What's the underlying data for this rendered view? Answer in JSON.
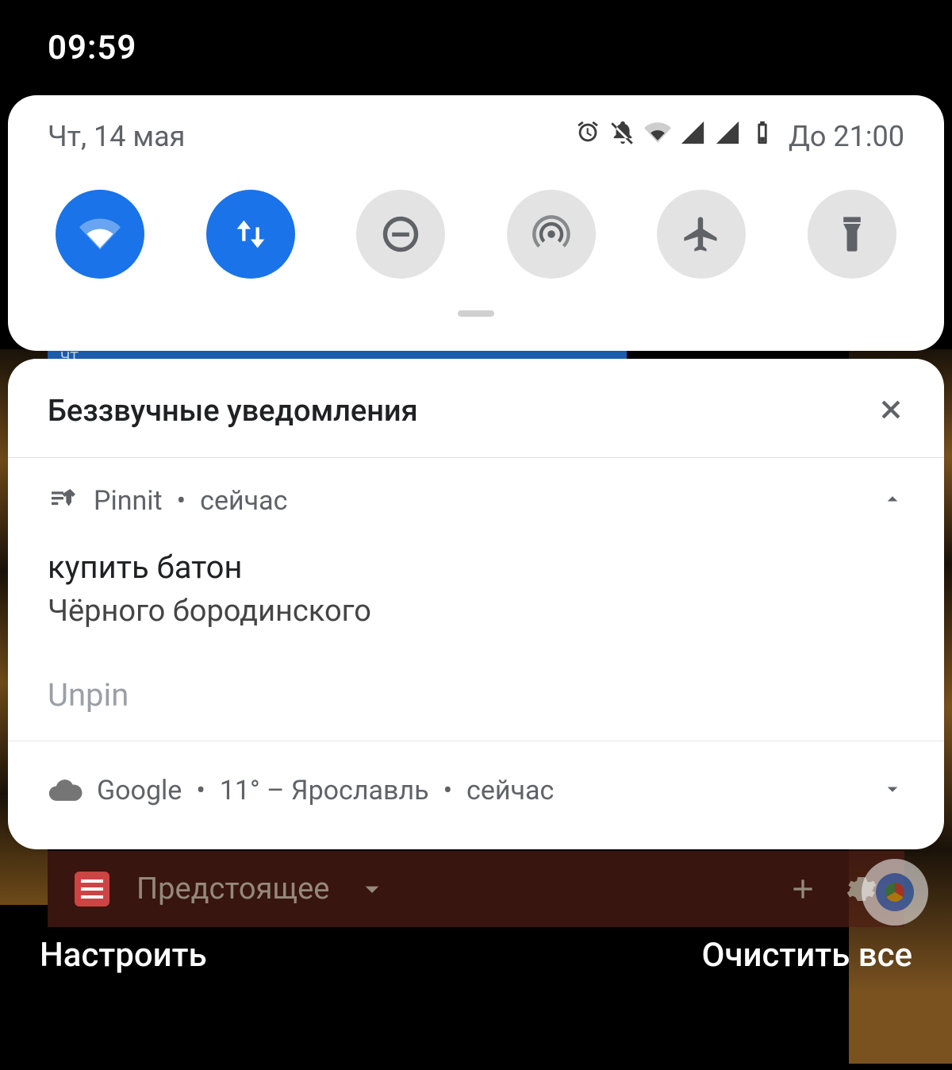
{
  "status_bar": {
    "time": "09:59"
  },
  "quick_settings": {
    "date": "Чт, 14 мая",
    "battery_until": "До 21:00",
    "tiles": [
      {
        "name": "wifi",
        "on": true
      },
      {
        "name": "mobile-data",
        "on": true
      },
      {
        "name": "do-not-disturb",
        "on": false
      },
      {
        "name": "hotspot",
        "on": false
      },
      {
        "name": "airplane-mode",
        "on": false
      },
      {
        "name": "flashlight",
        "on": false
      }
    ]
  },
  "silent_section": {
    "title": "Беззвучные уведомления"
  },
  "notifications": [
    {
      "app": "Pinnit",
      "time": "сейчас",
      "expanded": true,
      "title": "купить батон",
      "body": "Чёрного бородинского",
      "action": "Unpin"
    },
    {
      "app": "Google",
      "summary": "11° – Ярославль",
      "time": "сейчас",
      "expanded": false
    }
  ],
  "bottom": {
    "configure": "Настроить",
    "clear_all": "Очистить все"
  },
  "underlying_app": {
    "title": "Предстоящее",
    "day_abbrev": "ЧТ"
  }
}
